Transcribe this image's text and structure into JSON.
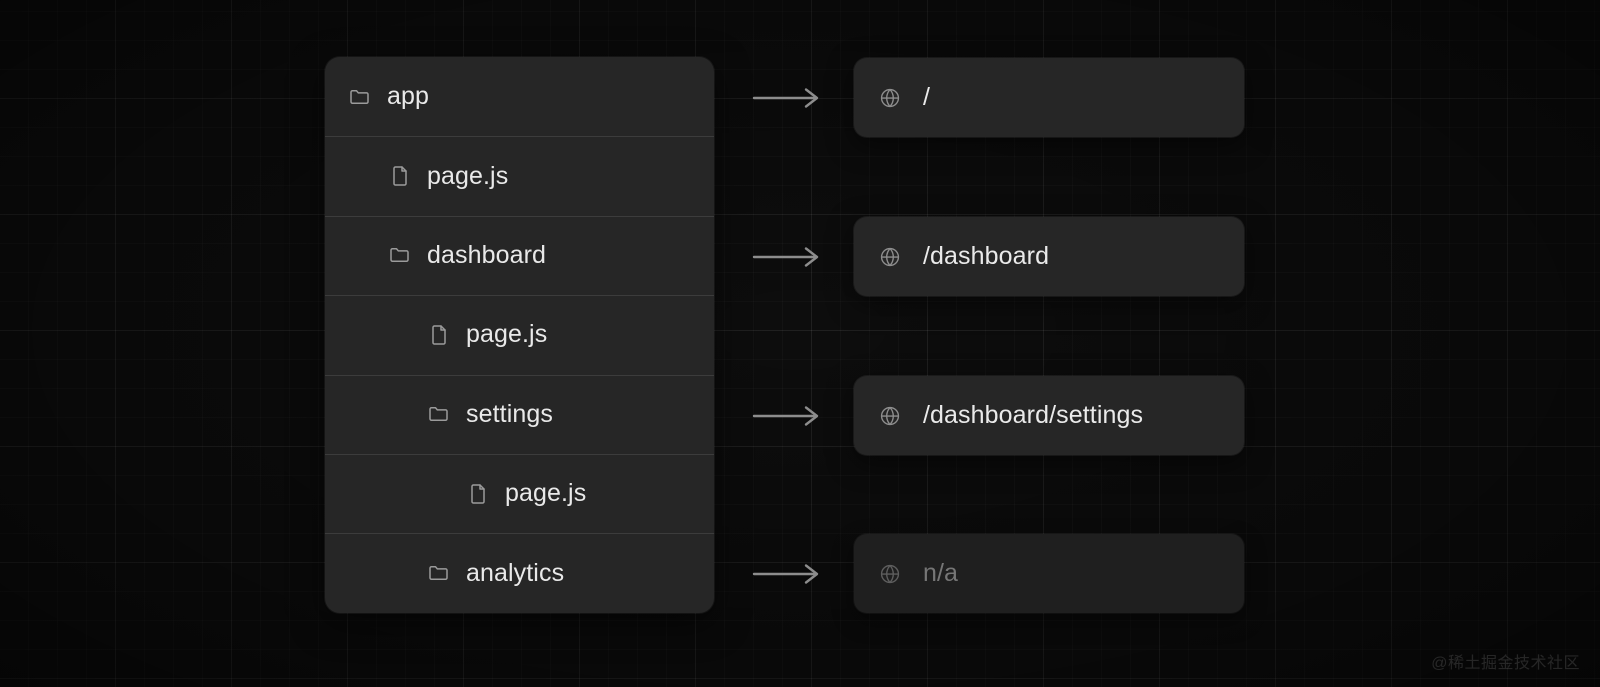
{
  "diagram": {
    "title": "Next.js app router file tree to route mapping",
    "colors": {
      "background": "#0d0d0d",
      "card": "#262626",
      "card_muted": "#1f1f1f",
      "text": "#eaeaea",
      "text_muted": "#767676",
      "icon": "#9b9b9b",
      "separator": "rgba(255,255,255,0.10)",
      "arrow": "#8d8d8d"
    }
  },
  "file_tree": {
    "rows": [
      {
        "label": "app",
        "icon": "folder-icon",
        "type": "folder",
        "indent": 0
      },
      {
        "label": "page.js",
        "icon": "file-icon",
        "type": "file",
        "indent": 1
      },
      {
        "label": "dashboard",
        "icon": "folder-icon",
        "type": "folder",
        "indent": 1
      },
      {
        "label": "page.js",
        "icon": "file-icon",
        "type": "file",
        "indent": 2
      },
      {
        "label": "settings",
        "icon": "folder-icon",
        "type": "folder",
        "indent": 2
      },
      {
        "label": "page.js",
        "icon": "file-icon",
        "type": "file",
        "indent": 3
      },
      {
        "label": "analytics",
        "icon": "folder-icon",
        "type": "folder",
        "indent": 2
      }
    ]
  },
  "routes": {
    "arrow_glyph": "long-right-arrow",
    "boxes": [
      {
        "label": "/",
        "icon": "globe-icon",
        "state": "active",
        "source_row": 0
      },
      {
        "label": "/dashboard",
        "icon": "globe-icon",
        "state": "active",
        "source_row": 2
      },
      {
        "label": "/dashboard/settings",
        "icon": "globe-icon",
        "state": "active",
        "source_row": 4
      },
      {
        "label": "n/a",
        "icon": "globe-icon",
        "state": "muted",
        "source_row": 6
      }
    ]
  },
  "watermark": {
    "text": "@稀土掘金技术社区"
  }
}
